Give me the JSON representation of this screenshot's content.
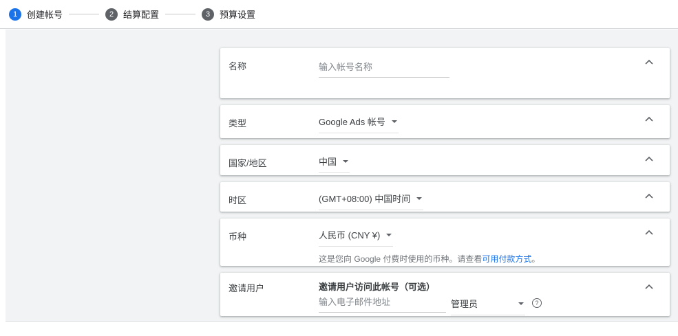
{
  "stepper": {
    "steps": [
      {
        "number": "1",
        "label": "创建帐号"
      },
      {
        "number": "2",
        "label": "结算配置"
      },
      {
        "number": "3",
        "label": "预算设置"
      }
    ]
  },
  "form": {
    "name": {
      "label": "名称",
      "placeholder": "输入帐号名称"
    },
    "type": {
      "label": "类型",
      "value": "Google Ads 帐号"
    },
    "country": {
      "label": "国家/地区",
      "value": "中国"
    },
    "timezone": {
      "label": "时区",
      "value": "(GMT+08:00) 中国时间"
    },
    "currency": {
      "label": "币种",
      "value": "人民币 (CNY ¥)",
      "helper_prefix": "这是您向 Google 付费时使用的币种。请查看",
      "helper_link": "可用付款方式",
      "helper_suffix": "。"
    },
    "invite": {
      "label": "邀请用户",
      "title": "邀请用户访问此帐号（可选）",
      "email_placeholder": "输入电子邮件地址",
      "role_value": "管理员",
      "help_icon_glyph": "?"
    }
  },
  "colors": {
    "accent_blue": "#1a73e8",
    "step_inactive": "#5f6368",
    "content_background": "#f1f3f4",
    "link": "#1a73e8"
  }
}
